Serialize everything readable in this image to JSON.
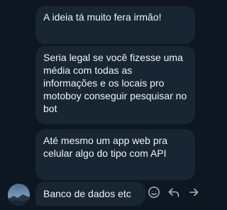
{
  "messages": [
    {
      "text": "A ideia tá muito fera irmão!"
    },
    {
      "text": "Seria legal se você fizesse uma média com todas as informações e os locais pro motoboy conseguir pesquisar no bot"
    },
    {
      "text": "Até mesmo um app web pra celular algo do tipo com API"
    },
    {
      "text": "Banco de dados etc"
    }
  ],
  "actions": {
    "react_icon": "emoji-smile-icon",
    "reply_icon": "reply-icon",
    "forward_icon": "forward-icon"
  },
  "colors": {
    "background": "#0e1621",
    "bubble": "#182533",
    "text": "#f0f4f8",
    "icon": "#aab3bd"
  }
}
